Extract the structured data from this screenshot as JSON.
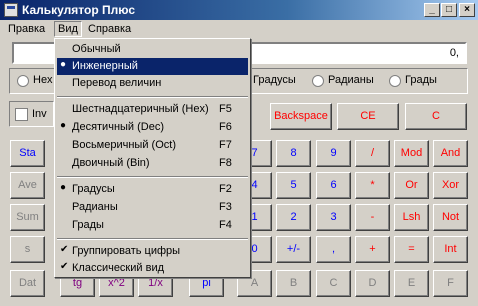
{
  "window": {
    "title": "Калькулятор Плюс",
    "controls": {
      "minimize": "_",
      "maximize": "□",
      "close": "×"
    }
  },
  "menubar": [
    "Правка",
    "Вид",
    "Справка"
  ],
  "display": {
    "value": "0,"
  },
  "radix": [
    "Hex"
  ],
  "angle": [
    "Градусы",
    "Радианы",
    "Грады"
  ],
  "inv": "Inv",
  "menu": {
    "items": [
      {
        "label": "Обычный"
      },
      {
        "label": "Инженерный",
        "mark": "●",
        "highlighted": true
      },
      {
        "label": "Перевод величин"
      },
      {
        "label": "Шестнадцатеричный (Hex)",
        "key": "F5"
      },
      {
        "label": "Десятичный (Dec)",
        "key": "F6",
        "mark": "●"
      },
      {
        "label": "Восьмеричный (Oct)",
        "key": "F7"
      },
      {
        "label": "Двоичный (Bin)",
        "key": "F8"
      },
      {
        "label": "Градусы",
        "key": "F2",
        "mark": "●"
      },
      {
        "label": "Радианы",
        "key": "F3"
      },
      {
        "label": "Грады",
        "key": "F4"
      },
      {
        "label": "Группировать цифры",
        "mark": "✔"
      },
      {
        "label": "Классический вид",
        "mark": "✔"
      }
    ]
  },
  "buttons": {
    "backspace": "Backspace",
    "ce": "CE",
    "c": "C",
    "left": [
      "Sta",
      "Ave",
      "Sum",
      "s",
      "Dat"
    ],
    "bottom_left": [
      "tg",
      "x^2",
      "1/x",
      "pi"
    ],
    "digits_r1": [
      "7",
      "8",
      "9",
      "/",
      "Mod",
      "And"
    ],
    "digits_r2": [
      "4",
      "5",
      "6",
      "*",
      "Or",
      "Xor"
    ],
    "digits_r3": [
      "1",
      "2",
      "3",
      "-",
      "Lsh",
      "Not"
    ],
    "digits_r4": [
      "0",
      "+/-",
      ",",
      "+",
      "=",
      "Int"
    ],
    "hex_row": [
      "A",
      "B",
      "C",
      "D",
      "E",
      "F"
    ]
  },
  "colors": {
    "title_start": "#0a246a",
    "highlight": "#0a246a",
    "button_blue": "#0000ff",
    "button_red": "#ff0000"
  }
}
